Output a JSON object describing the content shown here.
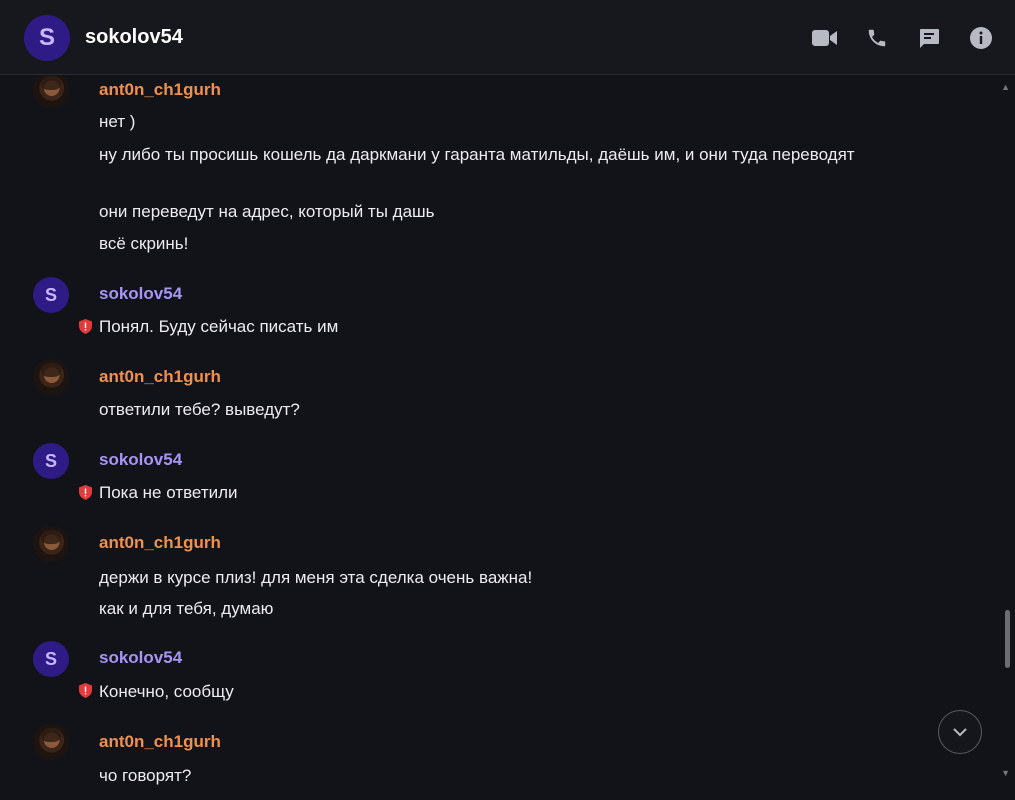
{
  "header": {
    "avatar_letter": "S",
    "title": "sokolov54",
    "icons": [
      "video-call-icon",
      "phone-icon",
      "chat-icon",
      "info-icon"
    ]
  },
  "colors": {
    "background": "#121319",
    "header_bg": "#17181e",
    "anton_name": "#f0904f",
    "sokolov_name": "#a794f5",
    "avatar_bg": "#2f1b86",
    "shield": "#e23b3b"
  },
  "messages": [
    {
      "user": "ant0n_ch1gurh",
      "lines": [
        "нет )",
        "ну либо ты просишь кошель да даркмани у гаранта матильды, даёшь им, и они туда переводят",
        "они переведут на адрес, который ты дашь",
        "всё скринь!"
      ]
    },
    {
      "user": "sokolov54",
      "avatar_letter": "S",
      "lines": [
        "Понял. Буду сейчас писать им"
      ]
    },
    {
      "user": "ant0n_ch1gurh",
      "lines": [
        "ответили тебе? выведут?"
      ]
    },
    {
      "user": "sokolov54",
      "avatar_letter": "S",
      "lines": [
        "Пока не ответили"
      ]
    },
    {
      "user": "ant0n_ch1gurh",
      "lines": [
        "держи в курсе плиз! для меня эта сделка очень важна!",
        "как и для тебя, думаю"
      ]
    },
    {
      "user": "sokolov54",
      "avatar_letter": "S",
      "lines": [
        "Конечно, сообщу"
      ]
    },
    {
      "user": "ant0n_ch1gurh",
      "lines": [
        "чо говорят?"
      ]
    }
  ]
}
